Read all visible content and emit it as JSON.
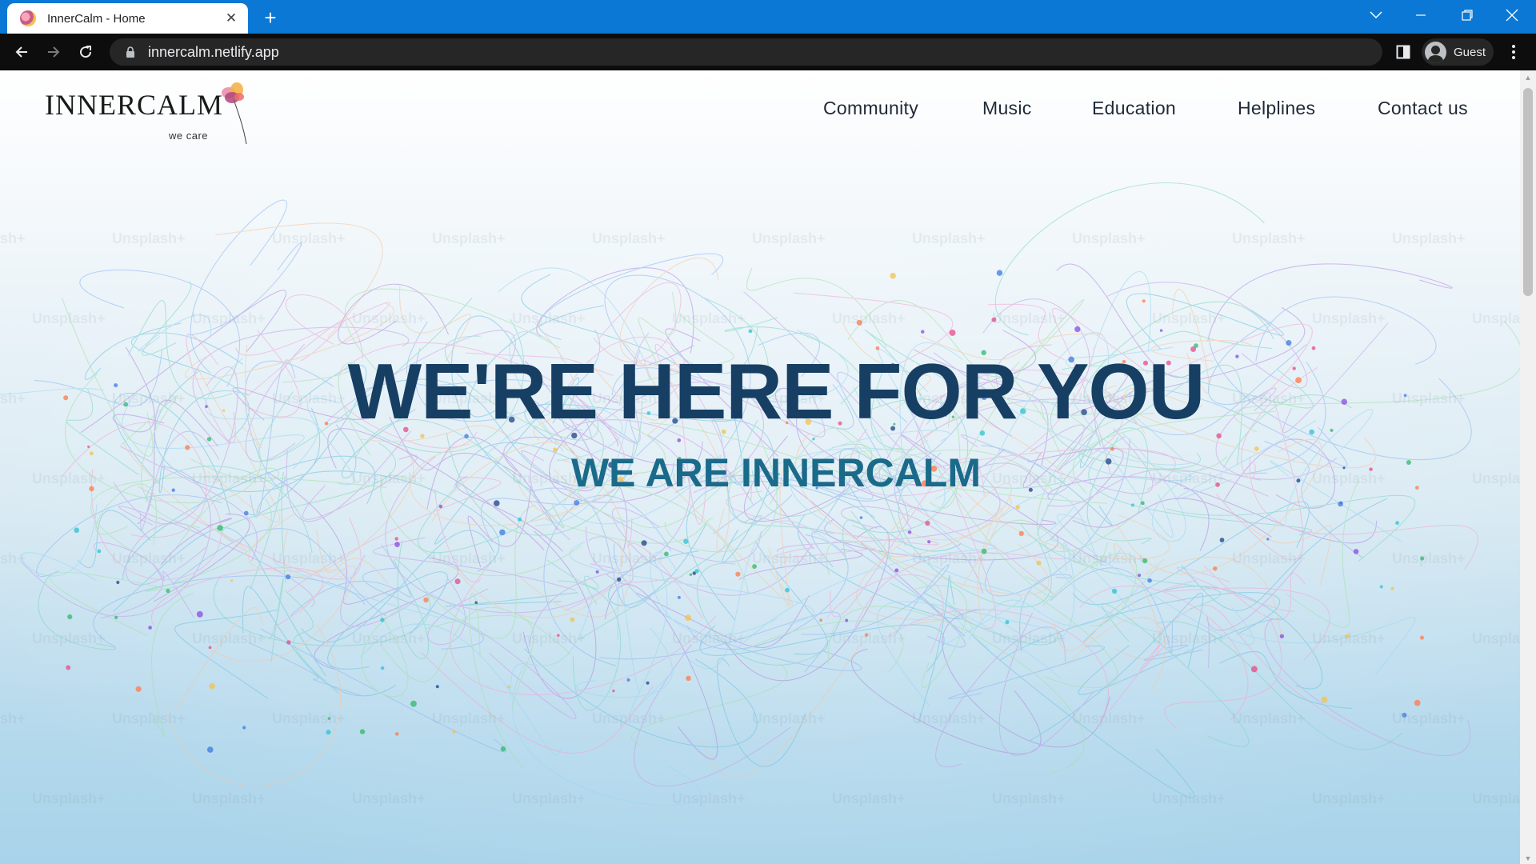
{
  "browser": {
    "tab_title": "InnerCalm - Home",
    "url": "innercalm.netlify.app",
    "profile_name": "Guest",
    "icons": {
      "favicon": "innercalm-flower-favicon",
      "tab_close": "close-icon",
      "new_tab": "plus-icon",
      "tab_search": "chevron-down-icon",
      "minimize": "minimize-icon",
      "restore": "restore-icon",
      "close": "close-icon",
      "back": "arrow-left-icon",
      "forward": "arrow-right-icon",
      "reload": "reload-icon",
      "lock": "lock-icon",
      "side_panel": "side-panel-icon",
      "avatar": "avatar-icon",
      "menu": "kebab-menu-icon"
    },
    "colors": {
      "tabstrip": "#0a78d4",
      "toolbar": "#0d0d0d",
      "omnibox": "#262626"
    }
  },
  "site": {
    "logo": {
      "name": "INNERCALM",
      "tagline": "we care",
      "icon": "flower-icon"
    },
    "nav": [
      "Community",
      "Music",
      "Education",
      "Helplines",
      "Contact us"
    ],
    "hero": {
      "title": "WE'RE HERE FOR YOU",
      "subtitle": "WE ARE INNERCALM",
      "background": "abstract colorful flowing particle lines",
      "watermark": "Unsplash+"
    },
    "colors": {
      "title": "#163f63",
      "subtitle": "#1a6a8a",
      "nav_text": "#1f2a37"
    }
  }
}
